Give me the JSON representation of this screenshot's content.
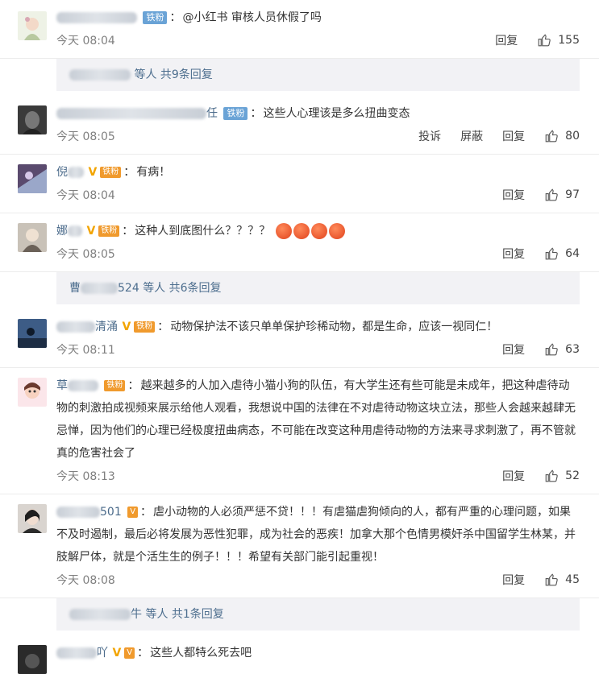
{
  "comments": [
    {
      "name": "",
      "name_suffix": "",
      "badge": "铁粉",
      "text": "@小红书 审核人员休假了吗",
      "time": "今天 08:04",
      "actions": [
        "回复"
      ],
      "likes": "155",
      "replies": {
        "suffix": "等人 共9条回复"
      }
    },
    {
      "name": "",
      "name_suffix": "任",
      "badge": "铁粉",
      "text": "这些人心理该是多么扭曲变态",
      "time": "今天 08:05",
      "actions": [
        "投诉",
        "屏蔽",
        "回复"
      ],
      "likes": "80"
    },
    {
      "name": "倪",
      "name_suffix": "",
      "badge": "铁粉",
      "text": "有病！",
      "time": "今天 08:04",
      "actions": [
        "回复"
      ],
      "likes": "97"
    },
    {
      "name": "娜",
      "name_suffix": "",
      "badge": "铁粉",
      "text": "这种人到底图什么？？？？",
      "time": "今天 08:05",
      "actions": [
        "回复"
      ],
      "likes": "64",
      "replies": {
        "prefix": "曹",
        "suffix_num": "524",
        "suffix": "等人 共6条回复"
      }
    },
    {
      "name": "",
      "name_suffix": "清涌",
      "badge": "铁粉",
      "text": "动物保护法不该只单单保护珍稀动物，都是生命，应该一视同仁！",
      "time": "今天 08:11",
      "actions": [
        "回复"
      ],
      "likes": "63"
    },
    {
      "name": "草",
      "name_suffix": "",
      "badge": "铁粉",
      "text": "越来越多的人加入虐待小猫小狗的队伍，有大学生还有些可能是未成年，把这种虐待动物的刺激拍成视频来展示给他人观看，我想说中国的法律在不对虐待动物这块立法，那些人会越来越肆无忌惮，因为他们的心理已经极度扭曲病态，不可能在改变这种用虐待动物的方法来寻求刺激了，再不管就真的危害社会了",
      "time": "今天 08:13",
      "actions": [
        "回复"
      ],
      "likes": "52"
    },
    {
      "name": "",
      "name_suffix": "501",
      "badge": "",
      "text": "虐小动物的人必须严惩不贷！！！有虐猫虐狗倾向的人，都有严重的心理问题，如果不及时遏制，最后必将发展为恶性犯罪，成为社会的恶疾！加拿大那个色情男模奸杀中国留学生林某，并肢解尸体，就是个活生生的例子！！！希望有关部门能引起重视！",
      "time": "今天 08:08",
      "actions": [
        "回复"
      ],
      "likes": "45",
      "replies": {
        "suffix_name": "牛",
        "suffix": "等人 共1条回复"
      }
    },
    {
      "name": "",
      "name_suffix": "吖",
      "badge": "",
      "text": "这些人都特么死去吧",
      "time": "",
      "actions": [],
      "likes": ""
    }
  ]
}
